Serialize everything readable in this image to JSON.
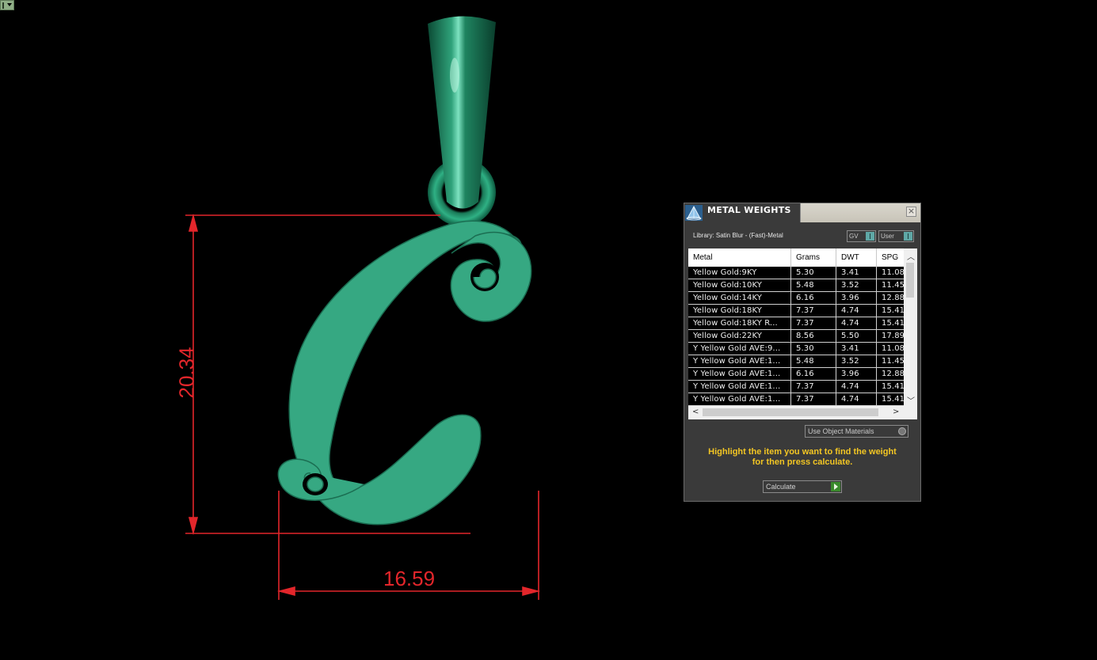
{
  "viewport": {
    "dimension_height": "20.34",
    "dimension_width": "16.59",
    "accent_color": "#3aad85",
    "dimension_color": "#e3262b"
  },
  "panel": {
    "title": "METAL WEIGHTS",
    "library": "Library: Satin Blur - (Fast)-Metal",
    "gv_label": "GV",
    "user_label": "User",
    "columns": [
      "Metal",
      "Grams",
      "DWT",
      "SPG"
    ],
    "rows": [
      [
        "Yellow Gold:9KY",
        "5.30",
        "3.41",
        "11.08"
      ],
      [
        "Yellow Gold:10KY",
        "5.48",
        "3.52",
        "11.45"
      ],
      [
        "Yellow Gold:14KY",
        "6.16",
        "3.96",
        "12.88"
      ],
      [
        "Yellow Gold:18KY",
        "7.37",
        "4.74",
        "15.41"
      ],
      [
        "Yellow Gold:18KY R...",
        "7.37",
        "4.74",
        "15.41"
      ],
      [
        "Yellow Gold:22KY",
        "8.56",
        "5.50",
        "17.89"
      ],
      [
        "Y Yellow Gold AVE:9...",
        "5.30",
        "3.41",
        "11.08"
      ],
      [
        "Y Yellow Gold AVE:1...",
        "5.48",
        "3.52",
        "11.45"
      ],
      [
        "Y Yellow Gold AVE:1...",
        "6.16",
        "3.96",
        "12.88"
      ],
      [
        "Y Yellow Gold AVE:1...",
        "7.37",
        "4.74",
        "15.41"
      ],
      [
        "Y Yellow Gold AVE:1...",
        "7.37",
        "4.74",
        "15.41"
      ]
    ],
    "use_object_materials": "Use Object Materials",
    "hint_line1": "Highlight the item you want to find the weight",
    "hint_line2": "for then press calculate.",
    "calculate_label": "Calculate"
  }
}
